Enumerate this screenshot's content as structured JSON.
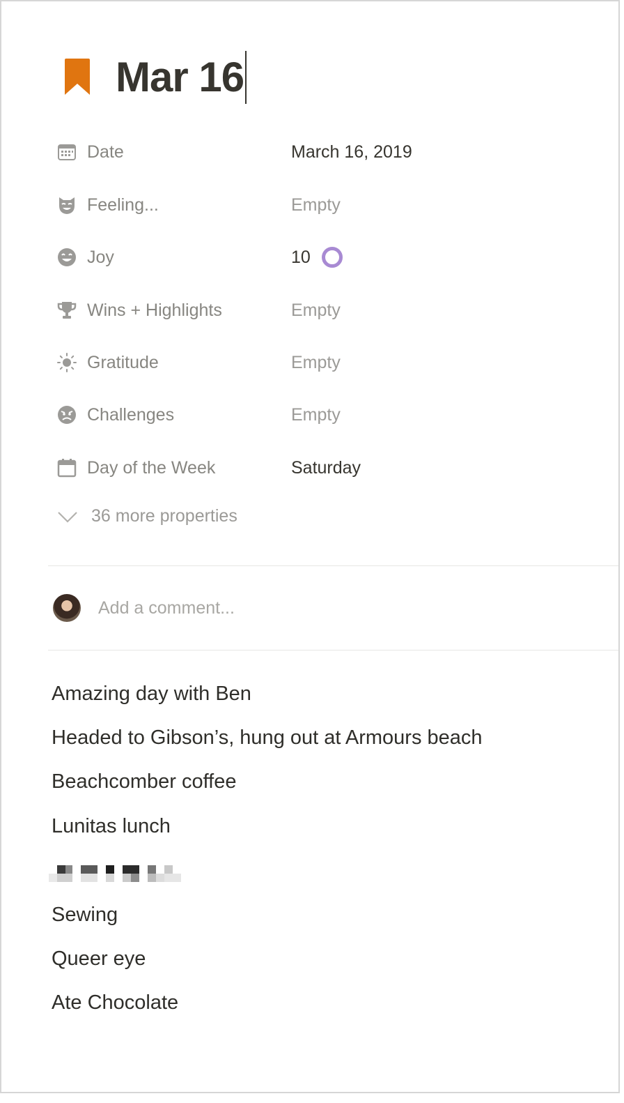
{
  "page": {
    "title": "Mar 16",
    "icon": "bookmark-icon",
    "icon_color": "#e07510"
  },
  "properties": [
    {
      "icon": "calendar-grid-icon",
      "name": "Date",
      "value": "March 16, 2019",
      "empty": false
    },
    {
      "icon": "mask-icon",
      "name": "Feeling...",
      "value": "Empty",
      "empty": true
    },
    {
      "icon": "smile-icon",
      "name": "Joy",
      "value": "10",
      "empty": false,
      "ring_color": "#a88ad3"
    },
    {
      "icon": "trophy-icon",
      "name": "Wins + Highlights",
      "value": "Empty",
      "empty": true
    },
    {
      "icon": "sun-icon",
      "name": "Gratitude",
      "value": "Empty",
      "empty": true
    },
    {
      "icon": "angry-face-icon",
      "name": "Challenges",
      "value": "Empty",
      "empty": true
    },
    {
      "icon": "calendar-icon",
      "name": "Day of the Week",
      "value": "Saturday",
      "empty": false
    }
  ],
  "more_properties": {
    "icon": "chevron-down-icon",
    "label": "36 more properties"
  },
  "comment": {
    "placeholder": "Add a comment..."
  },
  "body": {
    "lines": [
      "Amazing day with Ben",
      "Headed to Gibson’s, hung out at Armours beach",
      "Beachcomber coffee",
      "Lunitas lunch",
      "Sewing",
      "Queer eye",
      "Ate Chocolate"
    ]
  }
}
